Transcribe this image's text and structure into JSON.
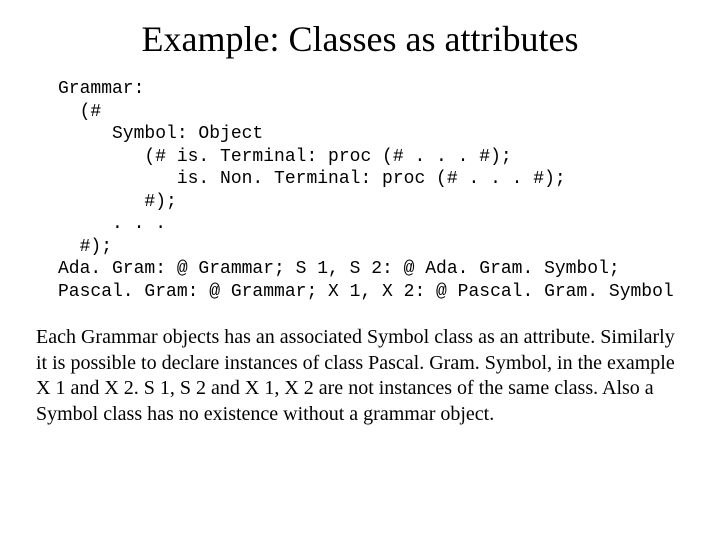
{
  "title": "Example: Classes as attributes",
  "code": "Grammar:\n  (#\n     Symbol: Object\n        (# is. Terminal: proc (# . . . #);\n           is. Non. Terminal: proc (# . . . #);\n        #);\n     . . .\n  #);\nAda. Gram: @ Grammar; S 1, S 2: @ Ada. Gram. Symbol;\nPascal. Gram: @ Grammar; X 1, X 2: @ Pascal. Gram. Symbol",
  "body": "Each Grammar objects has an associated Symbol class as an attribute. Similarly it is possible to declare instances of class Pascal. Gram. Symbol, in the example X 1 and X 2. S 1, S 2 and X 1, X 2 are not instances of the same class. Also a Symbol class has no existence without a grammar object."
}
